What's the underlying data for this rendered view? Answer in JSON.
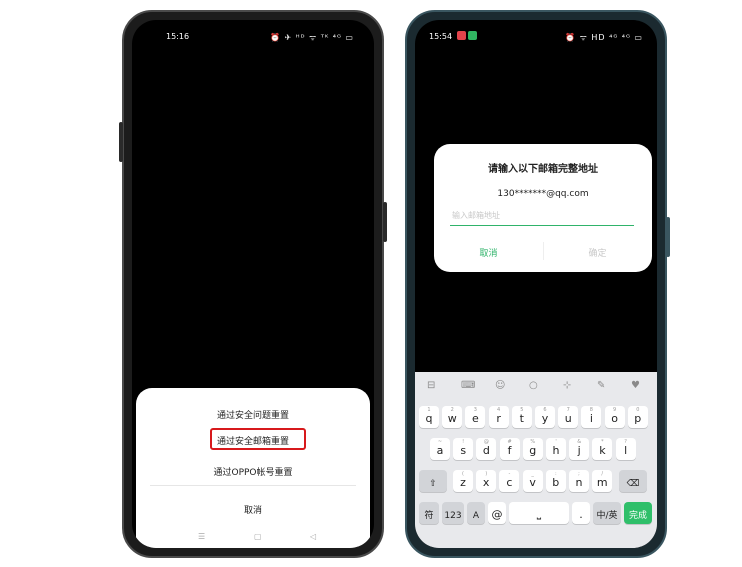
{
  "left": {
    "status": {
      "time": "15:16",
      "icons": "⏰ ✈ ᴴᴰ ᯤ ᵀᴷ ⁴ᴳ ▭"
    },
    "sheet": {
      "option_security_question": "通过安全问题重置",
      "option_security_email": "通过安全邮箱重置",
      "option_oppo_account": "通过OPPO帐号重置",
      "cancel": "取消"
    },
    "navbar": {
      "menu": "☰",
      "home": "▢",
      "back": "◁"
    }
  },
  "right": {
    "status": {
      "time": "15:54",
      "icons": "⏰ ᯤ HD ⁴ᴳ ⁴ᴳ ▭"
    },
    "dialog": {
      "title": "请输入以下邮箱完整地址",
      "email_hint": "130*******@qq.com",
      "input_placeholder": "输入邮箱地址",
      "cancel": "取消",
      "confirm": "确定"
    },
    "keyboard": {
      "toolbar": [
        "⊟",
        "⌨",
        "☺",
        "○",
        "⊹",
        "✎",
        "♥"
      ],
      "row1": [
        [
          "q",
          "1"
        ],
        [
          "w",
          "2"
        ],
        [
          "e",
          "3"
        ],
        [
          "r",
          "4"
        ],
        [
          "t",
          "5"
        ],
        [
          "y",
          "6"
        ],
        [
          "u",
          "7"
        ],
        [
          "i",
          "8"
        ],
        [
          "o",
          "9"
        ],
        [
          "p",
          "0"
        ]
      ],
      "row2": [
        [
          "a",
          "~"
        ],
        [
          "s",
          "!"
        ],
        [
          "d",
          "@"
        ],
        [
          "f",
          "#"
        ],
        [
          "g",
          "%"
        ],
        [
          "h",
          "'"
        ],
        [
          "j",
          "&"
        ],
        [
          "k",
          "*"
        ],
        [
          "l",
          "?"
        ]
      ],
      "row3": [
        [
          "z",
          "("
        ],
        [
          "x",
          ")"
        ],
        [
          "c",
          "-"
        ],
        [
          "v",
          "_"
        ],
        [
          "b",
          ":"
        ],
        [
          "n",
          ";"
        ],
        [
          "m",
          "/"
        ]
      ],
      "shift": "⇧",
      "backspace": "⌫",
      "symbol": "符",
      "number": "123",
      "emoji": "A",
      "at": "@",
      "space": "⎵",
      "period": ".",
      "lang": "中/英",
      "done": "完成"
    }
  },
  "colors": {
    "accent_green": "#2fb36a",
    "highlight_red": "#d7191c"
  }
}
